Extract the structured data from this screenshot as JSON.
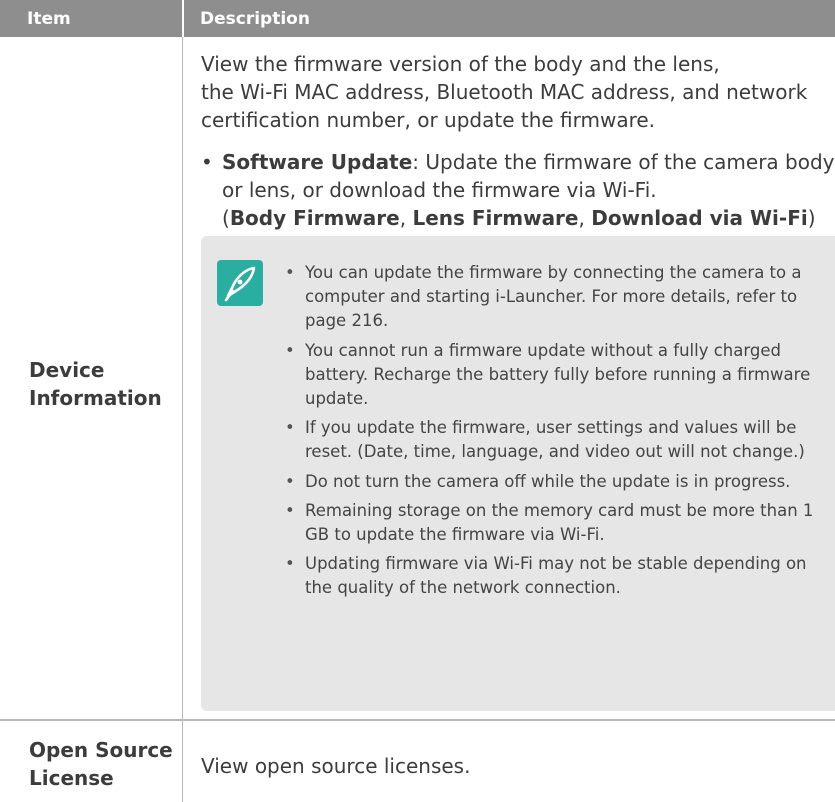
{
  "header": {
    "item": "Item",
    "description": "Description"
  },
  "rows": [
    {
      "item_line1": "Device",
      "item_line2": "Information",
      "intro_line1": "View the firmware version of the body and the lens,",
      "intro_line2": "the Wi-Fi MAC address, Bluetooth MAC address, and network",
      "intro_line3": "certification number, or update the firmware.",
      "bullet": {
        "title": "Software Update",
        "text_line1": ": Update the firmware of the camera body",
        "text_line2": "or lens, or download the firmware via Wi-Fi.",
        "open_paren": "(",
        "opt1": "Body Firmware",
        "sep1": ", ",
        "opt2": "Lens Firmware",
        "sep2": ", ",
        "opt3": "Download via Wi-Fi",
        "close_paren": ")"
      },
      "notes": [
        "You can update the firmware by connecting the camera to a computer and starting i-Launcher. For more details, refer to page 216.",
        "You cannot run a firmware update without a fully charged battery. Recharge the battery fully before running a firmware update.",
        "If you update the firmware, user settings and values will be reset. (Date, time, language, and video out will not change.)",
        "Do not turn the camera off while the update is in progress.",
        "Remaining storage on the memory card must be more than 1 GB to update the firmware via Wi-Fi.",
        "Updating firmware via Wi-Fi may not be stable depending on the quality of the network connection."
      ],
      "note_icon": "note-pen-icon",
      "note_icon_color": "#2aaea1"
    },
    {
      "item_line1": "Open Source",
      "item_line2": "License",
      "description": "View open source licenses."
    }
  ],
  "colors": {
    "header_bg": "#8e8e8e",
    "note_bg": "#e6e6e6",
    "text": "#3c3c3c"
  }
}
